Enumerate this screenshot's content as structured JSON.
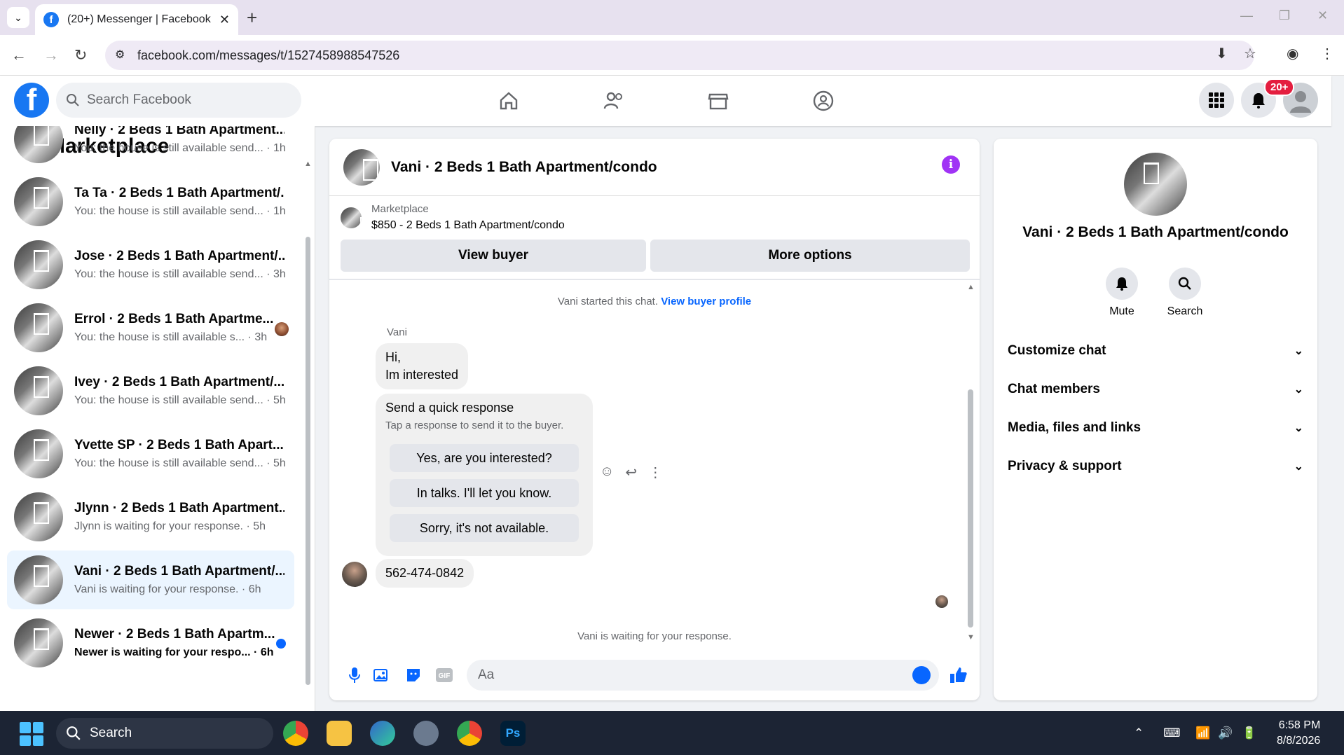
{
  "browser": {
    "tab_title": "(20+) Messenger | Facebook",
    "url": "facebook.com/messages/t/1527458988547526"
  },
  "fb": {
    "search_placeholder": "Search Facebook",
    "notif_badge": "20+"
  },
  "sidebar": {
    "title": "Marketplace",
    "conversations": [
      {
        "name": "Nelly · 2 Beds 1 Bath Apartment...",
        "preview": "You: the house is still available send... · 1h",
        "selected": false,
        "unread": false
      },
      {
        "name": "Ta Ta · 2 Beds 1 Bath Apartment/...",
        "preview": "You: the house is still available send... · 1h",
        "selected": false,
        "unread": false
      },
      {
        "name": "Jose · 2 Beds 1 Bath Apartment/...",
        "preview": "You: the house is still available send... · 3h",
        "selected": false,
        "unread": false
      },
      {
        "name": "Errol · 2 Beds 1 Bath Apartme...",
        "preview": "You: the house is still available s... · 3h",
        "selected": false,
        "unread": false
      },
      {
        "name": "Ivey · 2 Beds 1 Bath Apartment/...",
        "preview": "You: the house is still available send... · 5h",
        "selected": false,
        "unread": false
      },
      {
        "name": "Yvette SP · 2 Beds 1 Bath Apart...",
        "preview": "You: the house is still available send... · 5h",
        "selected": false,
        "unread": false
      },
      {
        "name": "Jlynn · 2 Beds 1 Bath Apartment...",
        "preview": "Jlynn is waiting for your response. · 5h",
        "selected": false,
        "unread": false
      },
      {
        "name": "Vani · 2 Beds 1 Bath Apartment/...",
        "preview": "Vani is waiting for your response. · 6h",
        "selected": true,
        "unread": false
      },
      {
        "name": "Newer · 2 Beds 1 Bath Apartm...",
        "preview": "Newer is waiting for your respo... · 6h",
        "selected": false,
        "unread": true
      }
    ]
  },
  "chat": {
    "title": "Vani · 2 Beds 1 Bath Apartment/condo",
    "listing_caption": "Marketplace",
    "listing_price": "$850 - 2 Beds 1 Bath Apartment/condo",
    "view_buyer": "View buyer",
    "more_options": "More options",
    "started": "Vani started this chat.",
    "view_profile": "View buyer profile",
    "sender": "Vani",
    "msg1_line1": "Hi,",
    "msg1_line2": "Im interested",
    "qr_title": "Send a quick response",
    "qr_sub": "Tap a response to send it to the buyer.",
    "qr_options": [
      "Yes, are you interested?",
      "In talks. I'll let you know.",
      "Sorry, it's not available."
    ],
    "msg2": "562-474-0842",
    "waiting": "Vani is waiting for your response.",
    "composer_placeholder": "Aa"
  },
  "details": {
    "name": "Vani · 2 Beds 1 Bath Apartment/condo",
    "mute": "Mute",
    "search": "Search",
    "sections": [
      "Customize chat",
      "Chat members",
      "Media, files and links",
      "Privacy & support"
    ]
  },
  "taskbar": {
    "search": "Search",
    "time": "6:58 PM",
    "date": "8/8/2026"
  },
  "colors": {
    "brand": "#1877f2",
    "accent": "#0866ff",
    "info": "#a033f5"
  }
}
